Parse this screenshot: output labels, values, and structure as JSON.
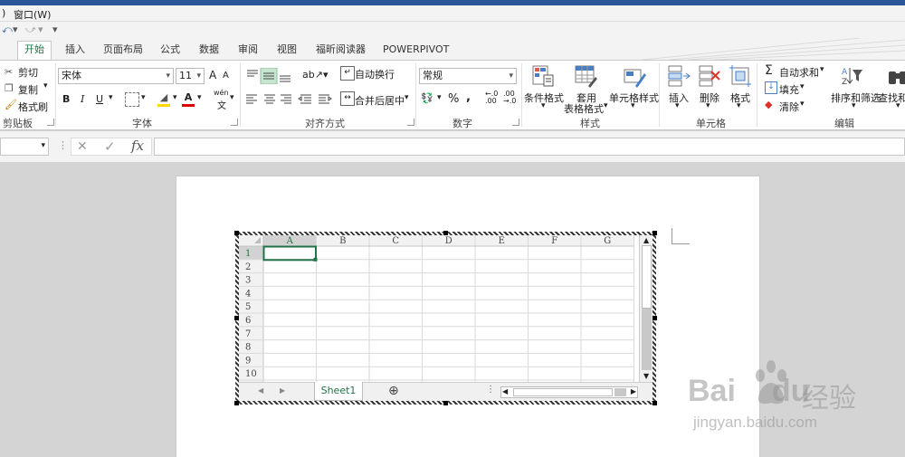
{
  "menu": {
    "partial": ")",
    "window": "窗口(W)"
  },
  "qat": {
    "undo": "⤺",
    "dropdown": "▾",
    "redo": "⤻",
    "customize": "▾"
  },
  "tabs": [
    "开始",
    "插入",
    "页面布局",
    "公式",
    "数据",
    "审阅",
    "视图",
    "福昕阅读器",
    "POWERPIVOT"
  ],
  "clipboard": {
    "cut": "剪切",
    "copy": "复制",
    "format_painter": "格式刷",
    "group": "剪贴板"
  },
  "font": {
    "name": "宋体",
    "size": "11",
    "group": "字体",
    "bold": "B",
    "italic": "I",
    "underline": "U",
    "grow": "A",
    "shrink": "A",
    "wen": "wén",
    "wen2": "文"
  },
  "align": {
    "wrap": "自动换行",
    "merge": "合并后居中",
    "group": "对齐方式"
  },
  "number": {
    "format": "常规",
    "percent": "%",
    "comma": ",",
    "dec_inc": ".00",
    "dec_dec": ".0",
    "group": "数字"
  },
  "styles": {
    "cond": "条件格式",
    "table1": "套用",
    "table2": "表格格式",
    "cell": "单元格样式",
    "group": "样式"
  },
  "cells": {
    "insert": "插入",
    "delete": "删除",
    "format": "格式",
    "group": "单元格"
  },
  "editing": {
    "autosum": "自动求和",
    "fill": "填充",
    "clear": "清除",
    "sort": "排序和筛选",
    "find": "查找和",
    "group": "编辑",
    "sigma": "Σ"
  },
  "formula": {
    "fx": "fx",
    "cancel": "✕",
    "enter": "✓",
    "sep": "⋮"
  },
  "sheet": {
    "columns": [
      "A",
      "B",
      "C",
      "D",
      "E",
      "F",
      "G"
    ],
    "rows": [
      "1",
      "2",
      "3",
      "4",
      "5",
      "6",
      "7",
      "8",
      "9",
      "10"
    ],
    "tab": "Sheet1",
    "add": "⊕"
  },
  "watermark": {
    "brand": "Bai",
    "brand2": "du",
    "cn": "经验",
    "url": "jingyan.baidu.com"
  }
}
